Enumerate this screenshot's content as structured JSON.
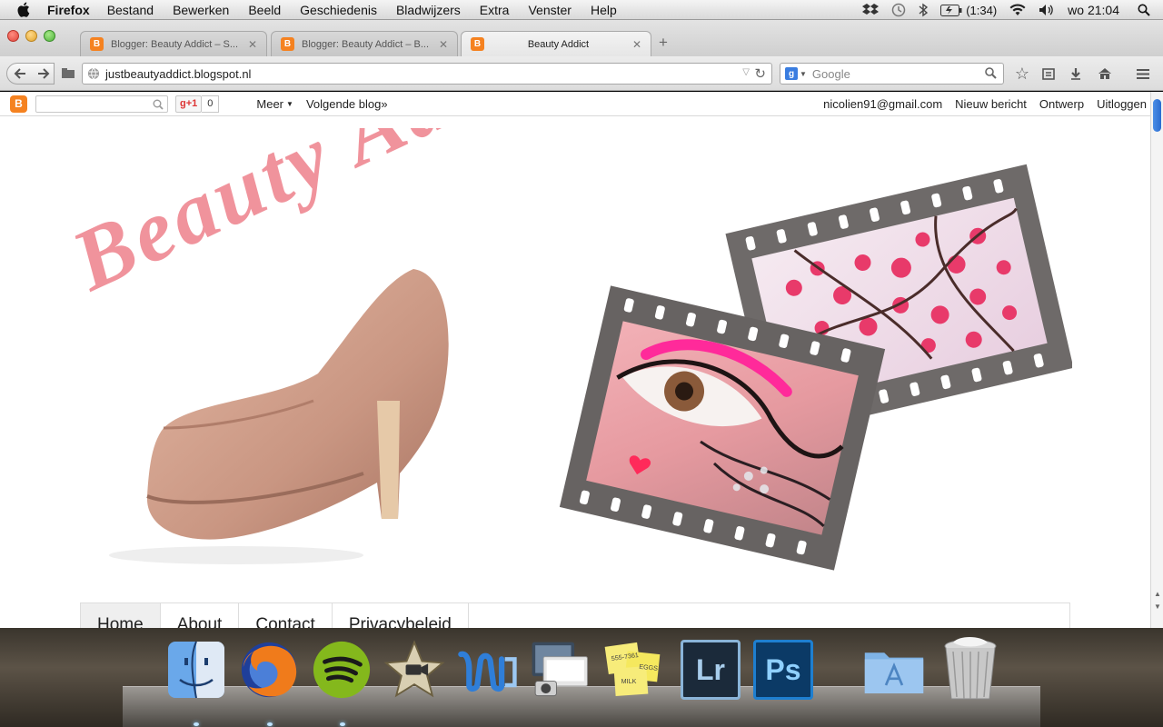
{
  "menubar": {
    "app_name": "Firefox",
    "items": [
      "Bestand",
      "Bewerken",
      "Beeld",
      "Geschiedenis",
      "Bladwijzers",
      "Extra",
      "Venster",
      "Help"
    ],
    "battery": "(1:34)",
    "clock": "wo 21:04"
  },
  "tabs": [
    {
      "title": "Blogger: Beauty Addict – S...",
      "active": false
    },
    {
      "title": "Blogger: Beauty Addict – B...",
      "active": false
    },
    {
      "title": "Beauty Addict",
      "active": true
    }
  ],
  "navbar": {
    "url": "justbeautyaddict.blogspot.nl",
    "search_placeholder": "Google"
  },
  "bloggerbar": {
    "gplus_label": "g+1",
    "gplus_count": "0",
    "more_label": "Meer",
    "next_blog": "Volgende blog»",
    "email": "nicolien91@gmail.com",
    "new_post": "Nieuw bericht",
    "design": "Ontwerp",
    "logout": "Uitloggen"
  },
  "blog": {
    "title": "Beauty Addict",
    "nav": [
      "Home",
      "About",
      "Contact",
      "Privacybeleid"
    ]
  },
  "colors": {
    "title_pink": "#f0939c",
    "blogger_orange": "#f58220"
  },
  "dock": {
    "icons": [
      "finder-icon",
      "firefox-icon",
      "spotify-icon",
      "imovie-icon",
      "word-icon",
      "screenshot-icon",
      "stickies-icon",
      "lightroom-icon",
      "photoshop-icon",
      "applications-folder-icon",
      "trash-icon"
    ],
    "stickies_text": [
      "555-7361",
      "EGGS",
      "MILK"
    ],
    "lightroom_label": "Lr",
    "photoshop_label": "Ps"
  }
}
